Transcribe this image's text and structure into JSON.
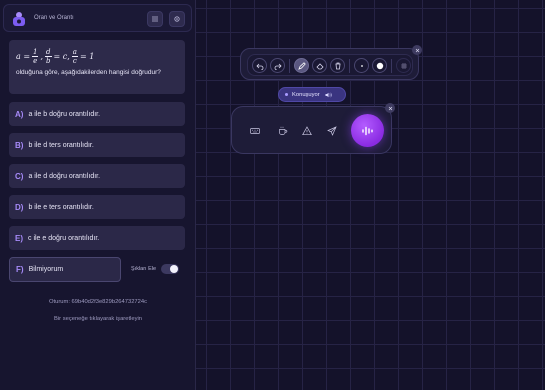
{
  "app": {
    "title": "Oran ve Orantı"
  },
  "question": {
    "formula": {
      "prefix": "a = ",
      "f1_num": "1",
      "f1_den": "e",
      "sep1": ", ",
      "f2_num": "d",
      "f2_den": "b",
      "mid": " = c, ",
      "f3_num": "a",
      "f3_den": "c",
      "suffix": " = 1"
    },
    "text": "olduğuna göre, aşağıdakilerden hangisi doğrudur?"
  },
  "options": [
    {
      "letter": "A)",
      "text": "a ile b doğru orantılıdır."
    },
    {
      "letter": "B)",
      "text": "b ile d ters orantılıdır."
    },
    {
      "letter": "C)",
      "text": "a ile d doğru orantılıdır."
    },
    {
      "letter": "D)",
      "text": "b ile e ters orantılıdır."
    },
    {
      "letter": "E)",
      "text": "c ile e doğru orantılıdır."
    }
  ],
  "unknown_option": {
    "letter": "F)",
    "text": "Bilmiyorum"
  },
  "shuffle": {
    "label": "Şıkları Ele",
    "on": false
  },
  "session": {
    "text": "Oturum: 69b40d2f3e829b264732724c"
  },
  "hint": "Bir seçeneğe tıklayarak işaretleyin",
  "status": {
    "speaking": "Konuşuyor"
  },
  "colors": {
    "accent": "#a78bfa",
    "mic": "#8a2be2",
    "background": "#14122a"
  },
  "toolbar_icons": [
    "undo-icon",
    "redo-icon",
    "pen-icon",
    "eraser-icon",
    "trash-icon",
    "small-dot-icon",
    "large-dot-icon",
    "grid-icon"
  ],
  "voice_icons": [
    "keyboard-icon",
    "coffee-icon",
    "warning-icon",
    "send-icon",
    "mic-icon"
  ]
}
